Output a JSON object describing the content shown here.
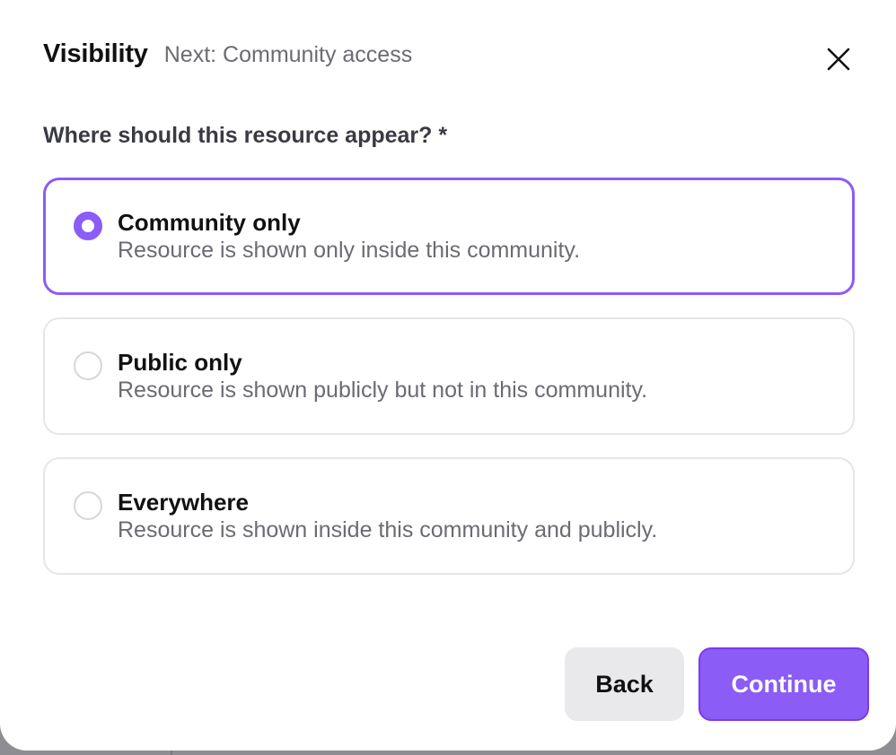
{
  "header": {
    "title": "Visibility",
    "next_step": "Next: Community access"
  },
  "question": "Where should this resource appear? *",
  "options": [
    {
      "title": "Community only",
      "description": "Resource is shown only inside this community.",
      "selected": true
    },
    {
      "title": "Public only",
      "description": "Resource is shown publicly but not in this community.",
      "selected": false
    },
    {
      "title": "Everywhere",
      "description": "Resource is shown inside this community and publicly.",
      "selected": false
    }
  ],
  "footer": {
    "back_label": "Back",
    "continue_label": "Continue"
  },
  "colors": {
    "accent": "#8b5cf6",
    "secondary_button": "#e9e9ec"
  },
  "icons": {
    "close": "close-icon"
  }
}
